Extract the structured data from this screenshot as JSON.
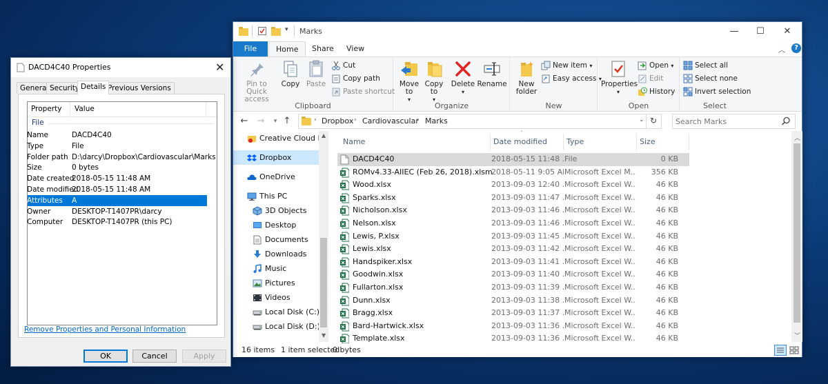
{
  "explorer": {
    "title": "Marks",
    "tabs": [
      {
        "label": "File"
      },
      {
        "label": "Home"
      },
      {
        "label": "Share"
      },
      {
        "label": "View"
      }
    ],
    "ribbon": {
      "clipboard": {
        "label": "Clipboard",
        "pin": "Pin to Quick access",
        "copy": "Copy",
        "paste": "Paste",
        "cut": "Cut",
        "copy_path": "Copy path",
        "paste_shortcut": "Paste shortcut"
      },
      "organize": {
        "label": "Organize",
        "move_to": "Move to",
        "copy_to": "Copy to",
        "delete": "Delete",
        "rename": "Rename"
      },
      "new": {
        "label": "New",
        "new_folder": "New folder",
        "new_item": "New item",
        "easy_access": "Easy access"
      },
      "open": {
        "label": "Open",
        "properties": "Properties",
        "open": "Open",
        "edit": "Edit",
        "history": "History"
      },
      "select": {
        "label": "Select",
        "select_all": "Select all",
        "select_none": "Select none",
        "invert_selection": "Invert selection"
      }
    },
    "breadcrumb": [
      "Dropbox",
      "Cardiovascular",
      "Marks"
    ],
    "search_placeholder": "Search Marks",
    "nav_items": [
      {
        "label": "Creative Cloud Fil",
        "icon": "creative-cloud-icon"
      },
      {
        "label": "Dropbox",
        "icon": "dropbox-icon"
      },
      {
        "label": "OneDrive",
        "icon": "onedrive-icon"
      },
      {
        "label": "This PC",
        "icon": "this-pc-icon"
      },
      {
        "label": "3D Objects",
        "icon": "3d-objects-icon"
      },
      {
        "label": "Desktop",
        "icon": "desktop-icon"
      },
      {
        "label": "Documents",
        "icon": "documents-icon"
      },
      {
        "label": "Downloads",
        "icon": "downloads-icon"
      },
      {
        "label": "Music",
        "icon": "music-icon"
      },
      {
        "label": "Pictures",
        "icon": "pictures-icon"
      },
      {
        "label": "Videos",
        "icon": "videos-icon"
      },
      {
        "label": "Local Disk (C:)",
        "icon": "local-disk-icon"
      },
      {
        "label": "Local Disk (D:)",
        "icon": "local-disk-icon"
      }
    ],
    "columns": {
      "name": "Name",
      "date": "Date modified",
      "type": "Type",
      "size": "Size"
    },
    "files": [
      {
        "name": "DACD4C40",
        "date": "2018-05-15 11:48 ...",
        "type": "File",
        "size": "0 KB",
        "kind": "file"
      },
      {
        "name": "ROMv4.33-AIIEC (Feb 26, 2018).xlsm",
        "date": "2018-05-11 9:05 AM",
        "type": "Microsoft Excel M...",
        "size": "356 KB",
        "kind": "excel"
      },
      {
        "name": "Wood.xlsx",
        "date": "2013-09-03 12:40 ...",
        "type": "Microsoft Excel W...",
        "size": "46 KB",
        "kind": "excel"
      },
      {
        "name": "Sparks.xlsx",
        "date": "2013-09-03 11:47 ...",
        "type": "Microsoft Excel W...",
        "size": "46 KB",
        "kind": "excel"
      },
      {
        "name": "Nicholson.xlsx",
        "date": "2013-09-03 11:46 ...",
        "type": "Microsoft Excel W...",
        "size": "46 KB",
        "kind": "excel"
      },
      {
        "name": "Nelson.xlsx",
        "date": "2013-09-03 11:46 ...",
        "type": "Microsoft Excel W...",
        "size": "46 KB",
        "kind": "excel"
      },
      {
        "name": "Lewis, P.xlsx",
        "date": "2013-09-03 11:45 ...",
        "type": "Microsoft Excel W...",
        "size": "46 KB",
        "kind": "excel"
      },
      {
        "name": "Lewis.xlsx",
        "date": "2013-09-03 11:42 ...",
        "type": "Microsoft Excel W...",
        "size": "46 KB",
        "kind": "excel"
      },
      {
        "name": "Handspiker.xlsx",
        "date": "2013-09-03 11:41 ...",
        "type": "Microsoft Excel W...",
        "size": "46 KB",
        "kind": "excel"
      },
      {
        "name": "Goodwin.xlsx",
        "date": "2013-09-03 11:40 ...",
        "type": "Microsoft Excel W...",
        "size": "46 KB",
        "kind": "excel"
      },
      {
        "name": "Fullarton.xlsx",
        "date": "2013-09-03 11:39 ...",
        "type": "Microsoft Excel W...",
        "size": "46 KB",
        "kind": "excel"
      },
      {
        "name": "Dunn.xlsx",
        "date": "2013-09-03 11:38 ...",
        "type": "Microsoft Excel W...",
        "size": "46 KB",
        "kind": "excel"
      },
      {
        "name": "Bragg.xlsx",
        "date": "2013-09-03 11:37 ...",
        "type": "Microsoft Excel W...",
        "size": "46 KB",
        "kind": "excel"
      },
      {
        "name": "Bard-Hartwick.xlsx",
        "date": "2013-09-03 11:36 ...",
        "type": "Microsoft Excel W...",
        "size": "46 KB",
        "kind": "excel"
      },
      {
        "name": "Template.xlsx",
        "date": "2013-09-03 11:36 ...",
        "type": "Microsoft Excel W...",
        "size": "46 KB",
        "kind": "excel"
      }
    ],
    "status": {
      "items": "16 items",
      "selected": "1 item selected",
      "size": "0 bytes"
    }
  },
  "properties": {
    "title": "DACD4C40 Properties",
    "tabs": [
      "General",
      "Security",
      "Details",
      "Previous Versions"
    ],
    "active_tab": "Details",
    "header": {
      "property": "Property",
      "value": "Value"
    },
    "section": "File",
    "rows": [
      {
        "key": "Name",
        "value": "DACD4C40"
      },
      {
        "key": "Type",
        "value": "File"
      },
      {
        "key": "Folder path",
        "value": "D:\\darcy\\Dropbox\\Cardiovascular\\Marks"
      },
      {
        "key": "Size",
        "value": "0 bytes"
      },
      {
        "key": "Date created",
        "value": "2018-05-15 11:48 AM"
      },
      {
        "key": "Date modified",
        "value": "2018-05-15 11:48 AM"
      },
      {
        "key": "Attributes",
        "value": "A"
      },
      {
        "key": "Owner",
        "value": "DESKTOP-T1407PR\\darcy"
      },
      {
        "key": "Computer",
        "value": "DESKTOP-T1407PR (this PC)"
      }
    ],
    "selected_row": "Attributes",
    "remove_link": "Remove Properties and Personal Information",
    "buttons": {
      "ok": "OK",
      "cancel": "Cancel",
      "apply": "Apply"
    }
  },
  "colors": {
    "accent": "#0078d7",
    "file_tab": "#1979ca",
    "excel_green": "#1e7145",
    "folder_yellow": "#f4c84a"
  }
}
